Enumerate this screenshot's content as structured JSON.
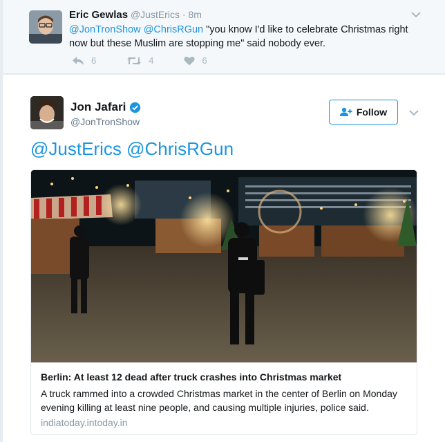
{
  "reply": {
    "name": "Eric Gewlas",
    "handle": "@JustErics",
    "separator": "·",
    "time": "8m",
    "mention1": "@JonTronShow",
    "mention2": "@ChrisRGun",
    "text": "\"you know I'd like to celebrate Christmas right now but these Muslim are stopping me\" said nobody ever.",
    "reply_count": "6",
    "retweet_count": "4",
    "like_count": "6"
  },
  "tweet": {
    "name": "Jon Jafari",
    "handle": "@JonTronShow",
    "follow_label": "Follow",
    "text": "@JustErics @ChrisRGun",
    "verified": true
  },
  "card": {
    "title": "Berlin: At least 12 dead after truck crashes into Christmas market",
    "description": "A truck rammed into a crowded Christmas market in the center of Berlin on Monday evening killing at least nine people, and causing multiple injuries, police said.",
    "domain": "indiatoday.intoday.in",
    "image_icon": "police-at-christmas-market-photo"
  },
  "colors": {
    "link_blue": "#1b95e0",
    "muted_gray": "#8899a6",
    "action_gray": "#aab8c2",
    "reply_bg": "#f5f8fa",
    "page_bg": "#e6ecf0"
  }
}
